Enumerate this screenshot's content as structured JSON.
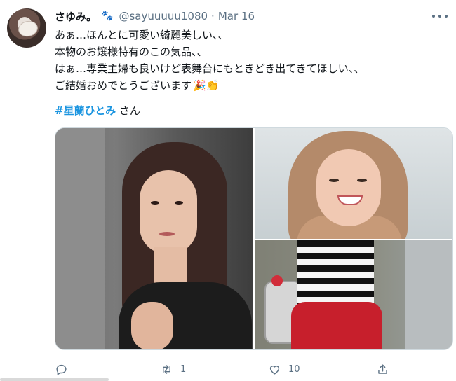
{
  "tweet": {
    "display_name": "さゆみ。",
    "paw_emoji": "🐾",
    "handle": "@sayuuuuu1080",
    "separator": "·",
    "date": "Mar 16",
    "lines": [
      "あぁ…ほんとに可愛い綺麗美しい、、",
      "本物のお嬢様特有のこの気品、、",
      "はぁ…専業主婦も良いけど表舞台にもときどき出てきてほしい、、",
      "ご結婚おめでとうございます"
    ],
    "line_emojis": "🎉👏",
    "hashtag": "#星蘭ひとみ",
    "hashtag_suffix": " さん"
  },
  "actions": {
    "reply_count": "",
    "retweet_count": "1",
    "like_count": "10",
    "share_count": ""
  },
  "colors": {
    "text": "#0f1419",
    "secondary": "#5b7083",
    "hashtag": "#1b95e0",
    "border": "#cfd9de"
  },
  "icons": [
    "reply-icon",
    "retweet-icon",
    "like-icon",
    "share-icon",
    "more-icon",
    "paw-icon"
  ]
}
